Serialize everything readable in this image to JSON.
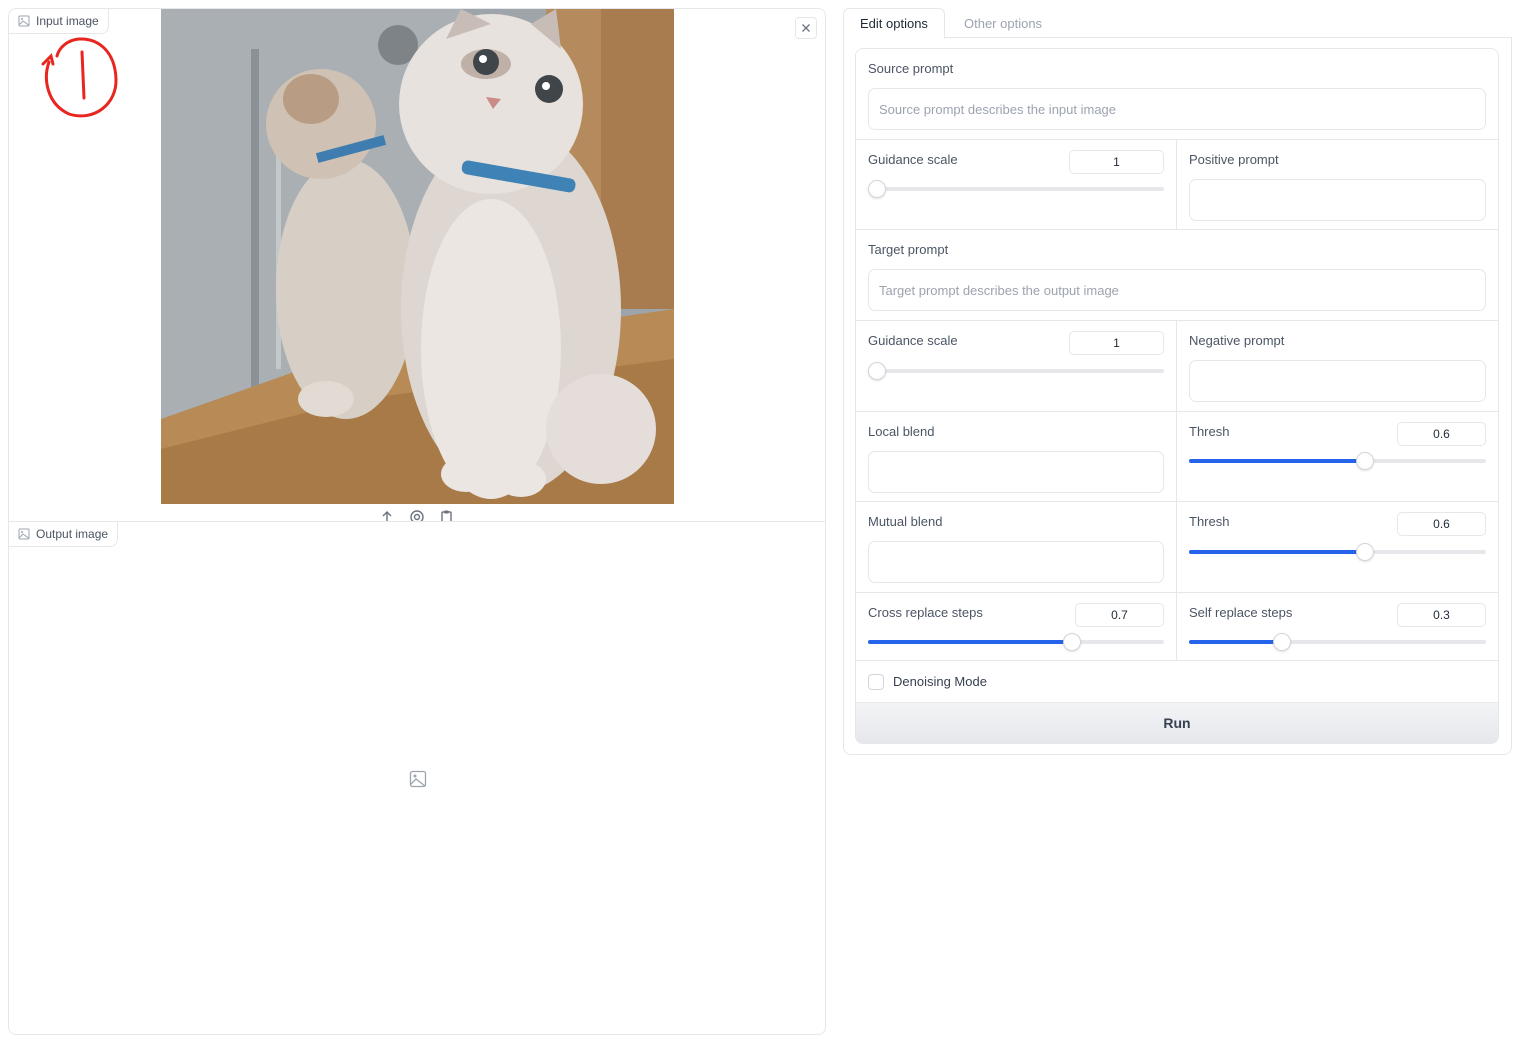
{
  "left": {
    "input_panel": {
      "label": "Input image",
      "label_icon": "image-icon",
      "close_icon": "close-icon",
      "tools": [
        "upload-icon",
        "webcam-icon",
        "clipboard-icon"
      ]
    },
    "output_panel": {
      "label": "Output image",
      "label_icon": "image-icon",
      "placeholder_icon": "image-icon"
    }
  },
  "tabs": [
    {
      "label": "Edit options",
      "active": true
    },
    {
      "label": "Other options",
      "active": false
    }
  ],
  "form": {
    "source_prompt": {
      "label": "Source prompt",
      "placeholder": "Source prompt describes the input image",
      "value": ""
    },
    "source_guidance": {
      "label": "Guidance scale",
      "value": "1",
      "fraction": 0.0
    },
    "positive_prompt": {
      "label": "Positive prompt",
      "value": ""
    },
    "target_prompt": {
      "label": "Target prompt",
      "placeholder": "Target prompt describes the output image",
      "value": ""
    },
    "target_guidance": {
      "label": "Guidance scale",
      "value": "1",
      "fraction": 0.0
    },
    "negative_prompt": {
      "label": "Negative prompt",
      "value": ""
    },
    "local_blend": {
      "label": "Local blend",
      "value": ""
    },
    "local_thresh": {
      "label": "Thresh",
      "value": "0.6",
      "fraction": 0.6
    },
    "mutual_blend": {
      "label": "Mutual blend",
      "value": ""
    },
    "mutual_thresh": {
      "label": "Thresh",
      "value": "0.6",
      "fraction": 0.6
    },
    "cross_replace_steps": {
      "label": "Cross replace steps",
      "value": "0.7",
      "fraction": 0.7
    },
    "self_replace_steps": {
      "label": "Self replace steps",
      "value": "0.3",
      "fraction": 0.3
    },
    "denoising_mode": {
      "label": "Denoising Mode",
      "checked": false
    },
    "run_label": "Run"
  },
  "colors": {
    "accent": "#2563eb",
    "border": "#e5e7eb",
    "annotation": "#e8261f"
  }
}
